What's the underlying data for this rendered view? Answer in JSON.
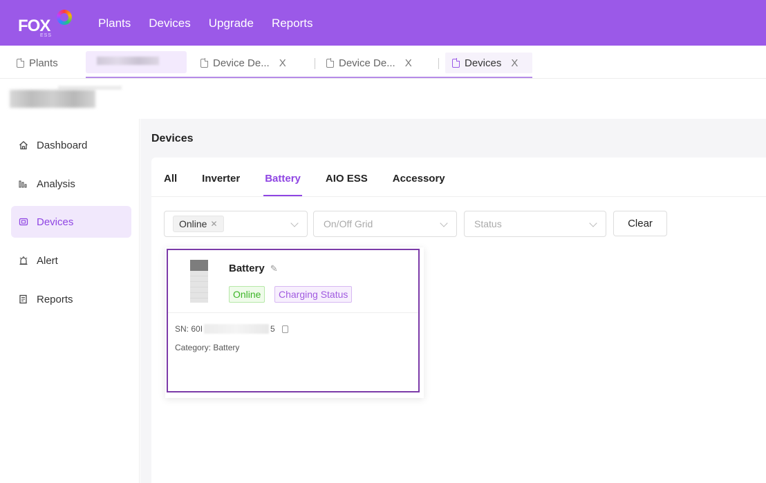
{
  "brand": {
    "logo_text": "FOX",
    "logo_subtext": "ESS"
  },
  "topnav": {
    "items": [
      "Plants",
      "Devices",
      "Upgrade",
      "Reports"
    ]
  },
  "tabs": {
    "plants": "Plants",
    "device_detail_1": "Device De...",
    "device_detail_2": "Device De...",
    "devices": "Devices",
    "close_glyph": "X"
  },
  "sidebar": {
    "items": [
      {
        "label": "Dashboard",
        "icon": "home-icon"
      },
      {
        "label": "Analysis",
        "icon": "bar-chart-icon"
      },
      {
        "label": "Devices",
        "icon": "device-icon",
        "active": true
      },
      {
        "label": "Alert",
        "icon": "alarm-icon"
      },
      {
        "label": "Reports",
        "icon": "report-icon"
      }
    ]
  },
  "main": {
    "title": "Devices",
    "categories": [
      "All",
      "Inverter",
      "Battery",
      "AIO ESS",
      "Accessory"
    ],
    "active_category": "Battery",
    "filters": {
      "status_chip": "Online",
      "grid_placeholder": "On/Off Grid",
      "status_placeholder": "Status",
      "clear_label": "Clear"
    },
    "device": {
      "name": "Battery",
      "status": "Online",
      "charging": "Charging Status",
      "sn_label": "SN:",
      "sn_prefix": "60I",
      "sn_suffix": "5",
      "category_label": "Category:",
      "category_value": "Battery"
    }
  },
  "colors": {
    "brand": "#9b59e8",
    "accent": "#8f45e3",
    "online": "#3cb527",
    "card_border": "#7b3aa8"
  }
}
